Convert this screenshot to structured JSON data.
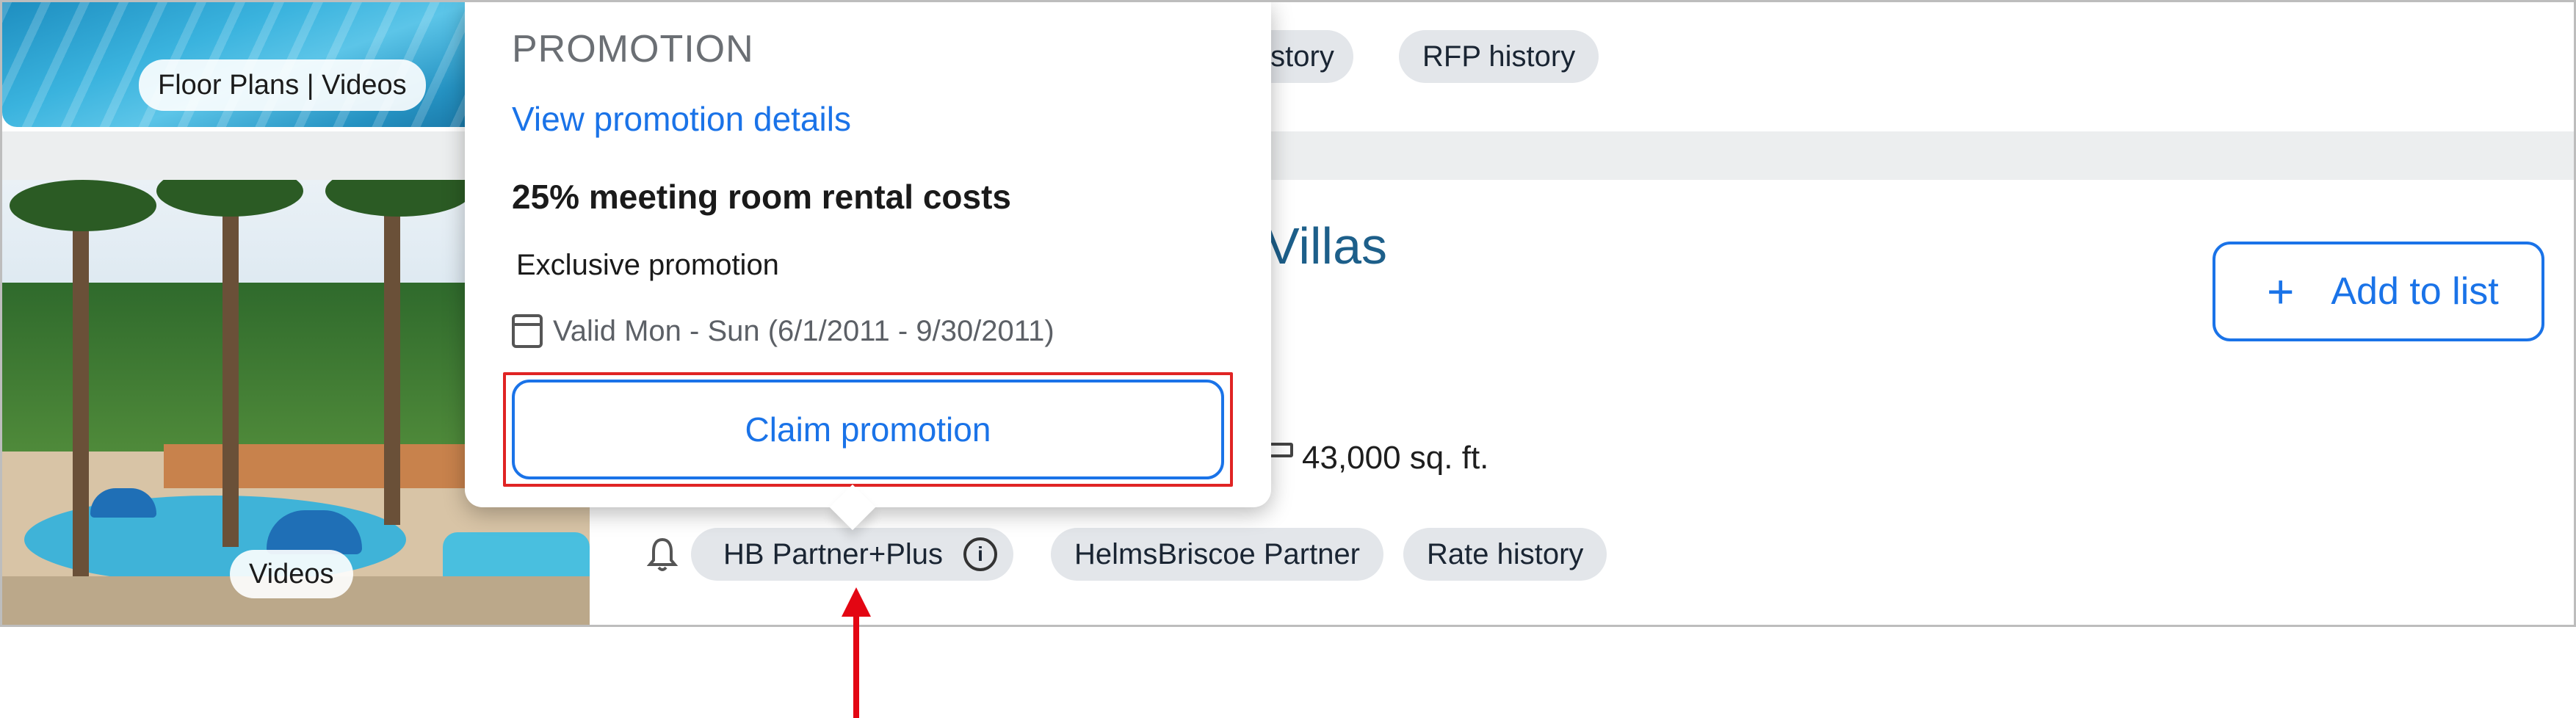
{
  "top_card": {
    "media_label": "Floor Plans | Videos",
    "tags": [
      "history",
      "RFP history"
    ]
  },
  "main_card": {
    "title_fragment": "Villas",
    "media_label": "Videos",
    "area": "43,000 sq. ft.",
    "add_button_label": "Add to list",
    "tags": {
      "hb_partner_plus": "HB Partner+Plus",
      "helmsbriscoe_partner": "HelmsBriscoe Partner",
      "rate_history": "Rate history"
    }
  },
  "popover": {
    "heading": "PROMOTION",
    "details_link": "View promotion details",
    "title": "25% meeting room rental costs",
    "description": "Exclusive promotion",
    "validity": "Valid Mon - Sun (6/1/2011 - 9/30/2011)",
    "claim_button": "Claim promotion"
  },
  "colors": {
    "primary": "#1a73e8",
    "title": "#1d5f8a",
    "tag_bg": "#e3e6ea",
    "highlight": "#e02424",
    "arrow": "#e30613"
  },
  "icons": [
    "calendar-icon",
    "info-icon",
    "bell-icon",
    "plus-icon",
    "ruler-icon"
  ]
}
